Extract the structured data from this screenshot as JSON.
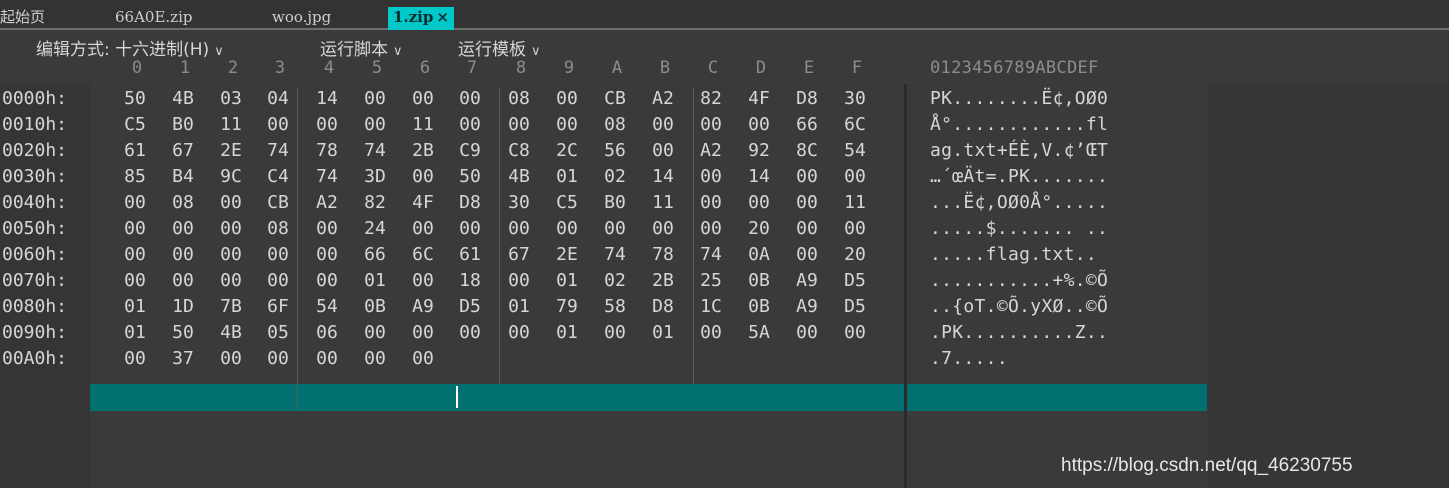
{
  "tabs": [
    {
      "label": "起始页",
      "active": false
    },
    {
      "label": "66A0E.zip",
      "active": false
    },
    {
      "label": "woo.jpg",
      "active": false
    },
    {
      "label": "1.zip",
      "active": true,
      "close": "×"
    }
  ],
  "menu": [
    {
      "label": "编辑方式: 十六进制(H)",
      "chevron": "∨"
    },
    {
      "label": "运行脚本",
      "chevron": "∨"
    },
    {
      "label": "运行模板",
      "chevron": "∨"
    }
  ],
  "hex_header": [
    "0",
    "1",
    "2",
    "3",
    "4",
    "5",
    "6",
    "7",
    "8",
    "9",
    "A",
    "B",
    "C",
    "D",
    "E",
    "F"
  ],
  "text_header": "0123456789ABCDEF",
  "rows": [
    {
      "addr": "0000h:",
      "bytes": [
        "50",
        "4B",
        "03",
        "04",
        "14",
        "00",
        "00",
        "00",
        "08",
        "00",
        "CB",
        "A2",
        "82",
        "4F",
        "D8",
        "30"
      ],
      "ascii": "PK........Ë¢‚OØ0"
    },
    {
      "addr": "0010h:",
      "bytes": [
        "C5",
        "B0",
        "11",
        "00",
        "00",
        "00",
        "11",
        "00",
        "00",
        "00",
        "08",
        "00",
        "00",
        "00",
        "66",
        "6C"
      ],
      "ascii": "Å°............fl"
    },
    {
      "addr": "0020h:",
      "bytes": [
        "61",
        "67",
        "2E",
        "74",
        "78",
        "74",
        "2B",
        "C9",
        "C8",
        "2C",
        "56",
        "00",
        "A2",
        "92",
        "8C",
        "54"
      ],
      "ascii": "ag.txt+ÉÈ,V.¢’ŒT"
    },
    {
      "addr": "0030h:",
      "bytes": [
        "85",
        "B4",
        "9C",
        "C4",
        "74",
        "3D",
        "00",
        "50",
        "4B",
        "01",
        "02",
        "14",
        "00",
        "14",
        "00",
        "00"
      ],
      "ascii": "…´œÄt=.PK......."
    },
    {
      "addr": "0040h:",
      "bytes": [
        "00",
        "08",
        "00",
        "CB",
        "A2",
        "82",
        "4F",
        "D8",
        "30",
        "C5",
        "B0",
        "11",
        "00",
        "00",
        "00",
        "11"
      ],
      "ascii": "...Ë¢‚OØ0Å°....."
    },
    {
      "addr": "0050h:",
      "bytes": [
        "00",
        "00",
        "00",
        "08",
        "00",
        "24",
        "00",
        "00",
        "00",
        "00",
        "00",
        "00",
        "00",
        "20",
        "00",
        "00"
      ],
      "ascii": ".....$....... .."
    },
    {
      "addr": "0060h:",
      "bytes": [
        "00",
        "00",
        "00",
        "00",
        "00",
        "66",
        "6C",
        "61",
        "67",
        "2E",
        "74",
        "78",
        "74",
        "0A",
        "00",
        "20"
      ],
      "ascii": ".....flag.txt.. "
    },
    {
      "addr": "0070h:",
      "bytes": [
        "00",
        "00",
        "00",
        "00",
        "00",
        "01",
        "00",
        "18",
        "00",
        "01",
        "02",
        "2B",
        "25",
        "0B",
        "A9",
        "D5"
      ],
      "ascii": "...........+%.©Õ"
    },
    {
      "addr": "0080h:",
      "bytes": [
        "01",
        "1D",
        "7B",
        "6F",
        "54",
        "0B",
        "A9",
        "D5",
        "01",
        "79",
        "58",
        "D8",
        "1C",
        "0B",
        "A9",
        "D5"
      ],
      "ascii": "..{oT.©Õ.yXØ..©Õ"
    },
    {
      "addr": "0090h:",
      "bytes": [
        "01",
        "50",
        "4B",
        "05",
        "06",
        "00",
        "00",
        "00",
        "00",
        "01",
        "00",
        "01",
        "00",
        "5A",
        "00",
        "00"
      ],
      "ascii": ".PK..........Z.."
    },
    {
      "addr": "00A0h:",
      "bytes": [
        "00",
        "37",
        "00",
        "00",
        "00",
        "00",
        "00"
      ],
      "ascii": ".7....."
    }
  ],
  "watermark": "https://blog.csdn.net/qq_46230755"
}
